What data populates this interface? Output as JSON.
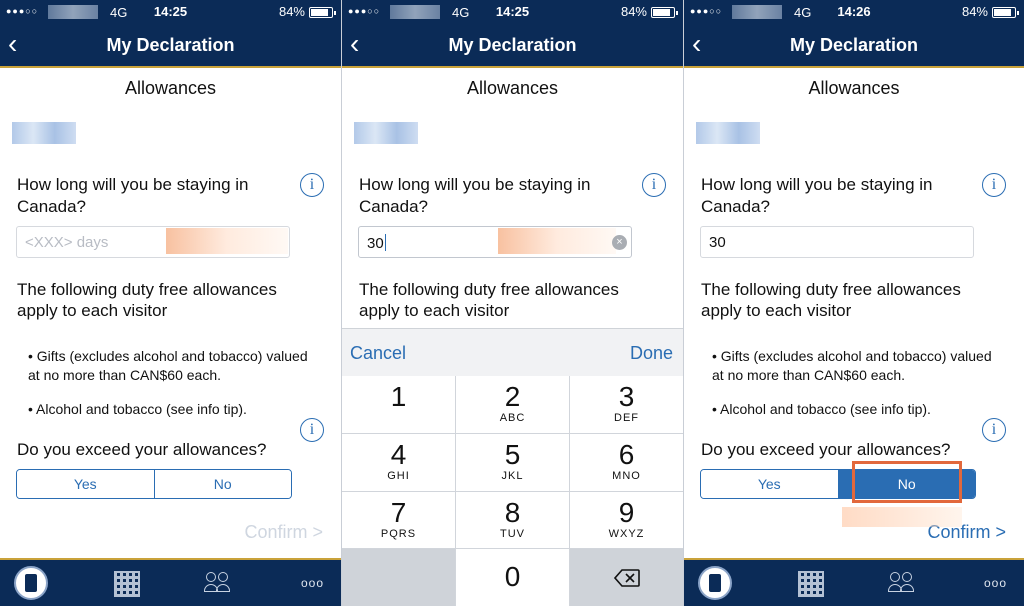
{
  "status_bar": {
    "panels": [
      {
        "network": "4G",
        "time": "14:25",
        "battery": "84%"
      },
      {
        "network": "4G",
        "time": "14:25",
        "battery": "84%"
      },
      {
        "network": "4G",
        "time": "14:26",
        "battery": "84%"
      }
    ]
  },
  "nav": {
    "title": "My Declaration",
    "back_icon": "chevron-left-icon"
  },
  "content": {
    "section_title": "Allowances",
    "question": "How long will you be staying in Canada?",
    "days_placeholder": "<XXX> days",
    "days_value_typed": "30",
    "days_value_final": "30",
    "allowance_intro": "The following duty free allowances apply to each visitor",
    "bullets": [
      "• Gifts (excludes alcohol and tobacco) valued at no more than CAN$60 each.",
      "• Alcohol and tobacco (see info tip)."
    ],
    "exceed_question": "Do you exceed your allowances?",
    "yes_label": "Yes",
    "no_label": "No",
    "confirm_label": "Confirm >",
    "info_glyph": "i"
  },
  "keyboard": {
    "cancel_label": "Cancel",
    "done_label": "Done",
    "keys": [
      {
        "num": "1",
        "letters": ""
      },
      {
        "num": "2",
        "letters": "ABC"
      },
      {
        "num": "3",
        "letters": "DEF"
      },
      {
        "num": "4",
        "letters": "GHI"
      },
      {
        "num": "5",
        "letters": "JKL"
      },
      {
        "num": "6",
        "letters": "MNO"
      },
      {
        "num": "7",
        "letters": "PQRS"
      },
      {
        "num": "8",
        "letters": "TUV"
      },
      {
        "num": "9",
        "letters": "WXYZ"
      },
      {
        "num": "0",
        "letters": ""
      }
    ]
  },
  "tabbar": {
    "icons": [
      "passport-scan-icon",
      "qr-code-icon",
      "people-icon",
      "more-dots-icon"
    ],
    "more_glyph": "ooo"
  },
  "colors": {
    "navy": "#0b2b57",
    "accent_blue": "#2a6db3",
    "gold": "#c9a23a",
    "highlight": "#e2683c"
  }
}
